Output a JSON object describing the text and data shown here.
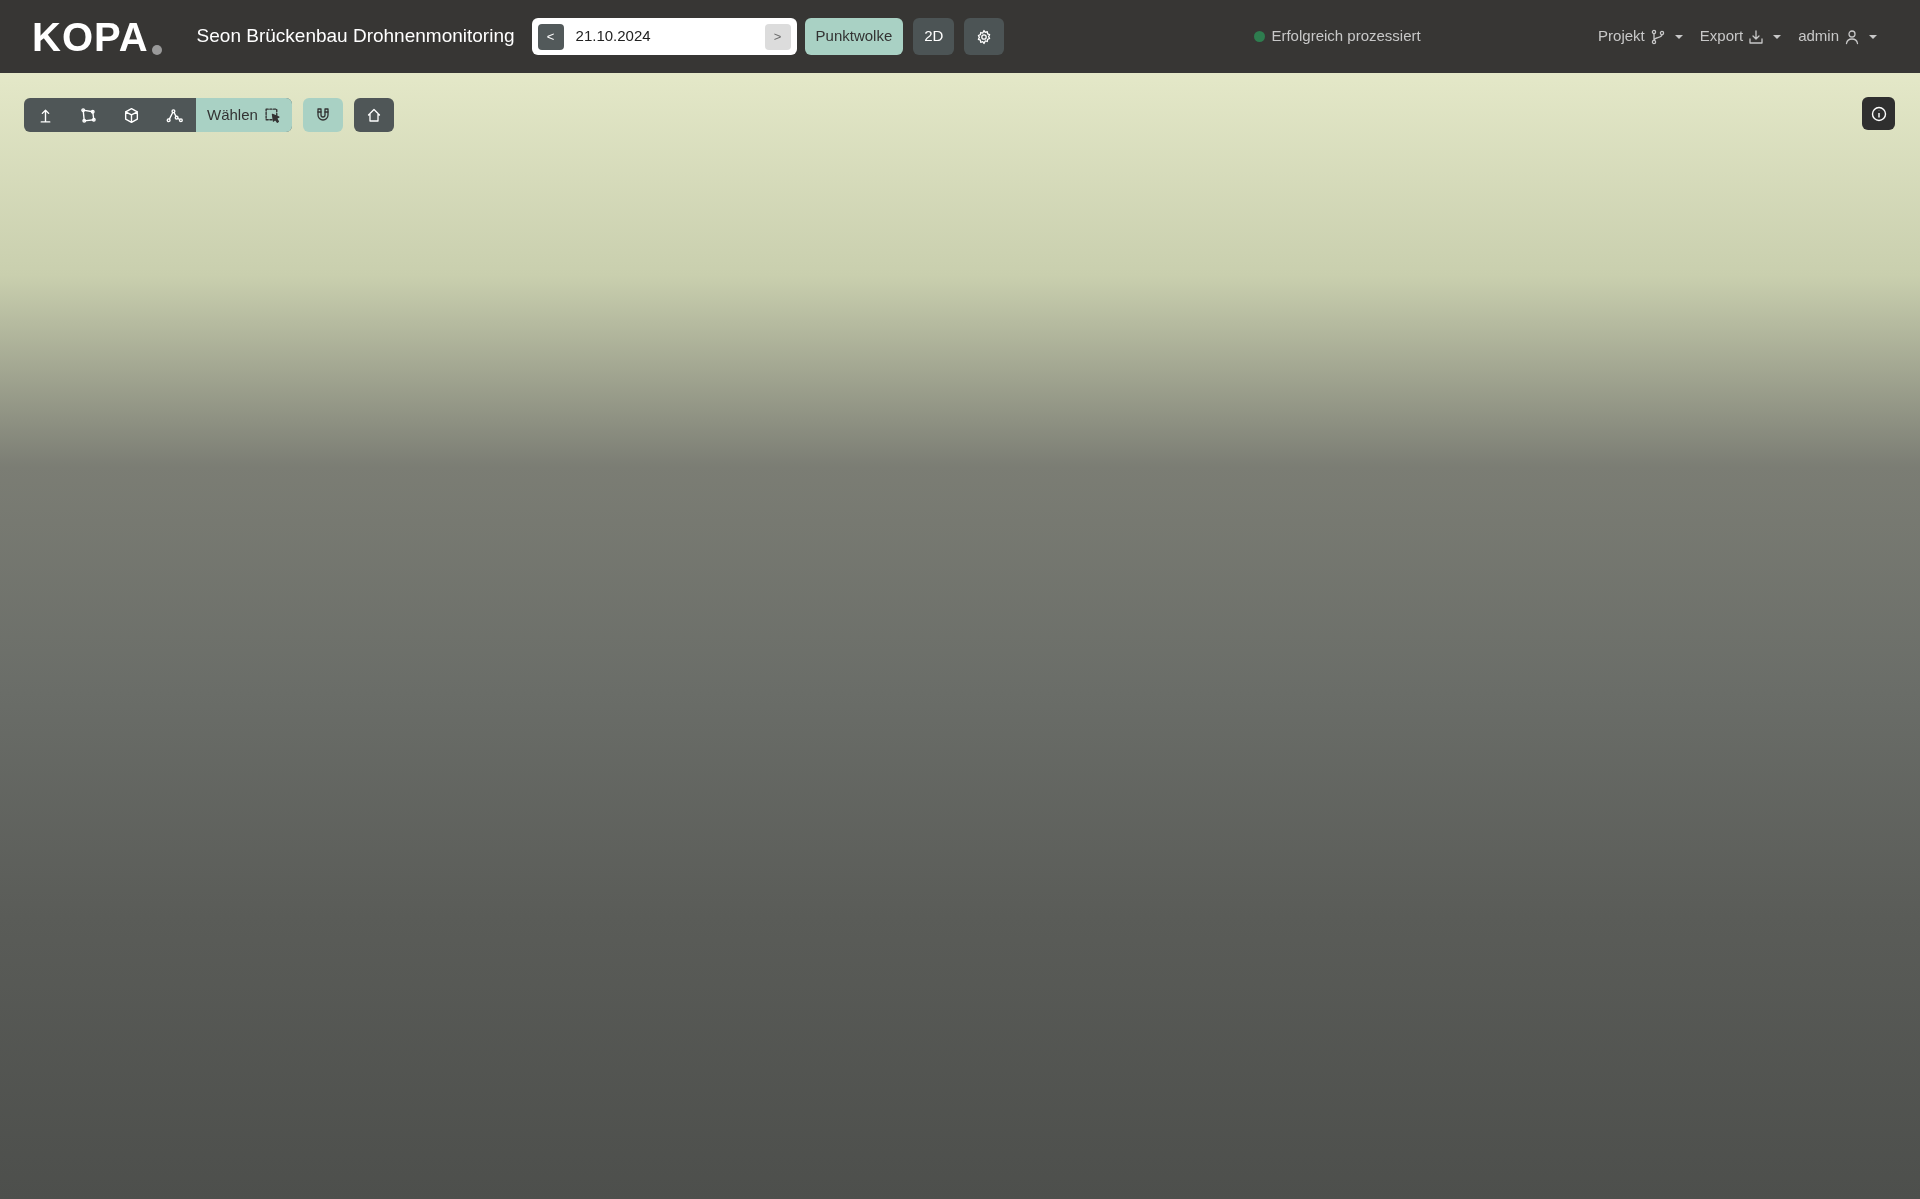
{
  "header": {
    "logo": "KOPA",
    "project_title": "Seon Brückenbau Drohnenmonitoring",
    "date_nav": {
      "prev": "<",
      "date": "21.10.2024",
      "next": ">",
      "next_disabled": true
    },
    "view_modes": [
      {
        "label": "Punktwolke",
        "selected": true
      },
      {
        "label": "2D",
        "selected": false
      }
    ],
    "status": {
      "text": "Erfolgreich prozessiert",
      "color": "#2e7d4f"
    },
    "menus": [
      {
        "label": "Projekt"
      },
      {
        "label": "Export"
      },
      {
        "label": "admin"
      }
    ]
  },
  "toolbar": {
    "tools": [
      {
        "kind": "icon",
        "selected": false
      },
      {
        "kind": "icon",
        "selected": false
      },
      {
        "kind": "icon",
        "selected": false
      },
      {
        "kind": "icon",
        "selected": false
      },
      {
        "kind": "labeled",
        "label": "Wählen",
        "selected": true
      }
    ],
    "snap": {
      "selected": true
    },
    "home": {
      "selected": false
    }
  }
}
